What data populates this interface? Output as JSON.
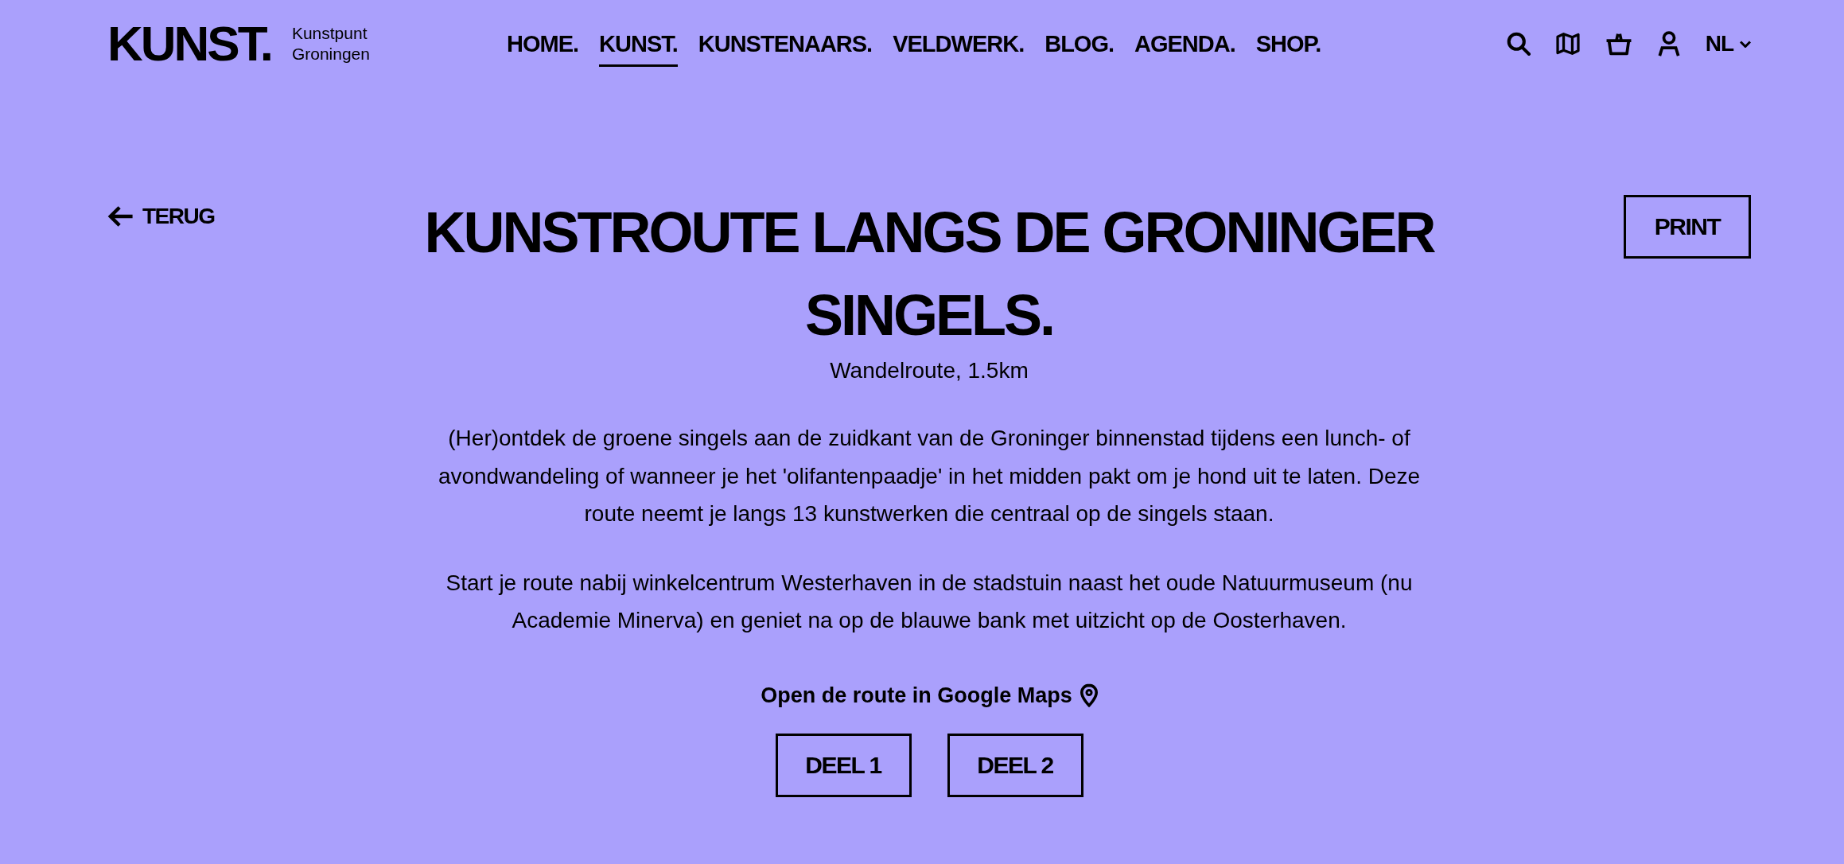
{
  "header": {
    "logo": {
      "wordmark": "KUNST.",
      "tagline": "Kunstpunt Groningen"
    },
    "nav": [
      {
        "label": "HOME.",
        "selected": false
      },
      {
        "label": "KUNST.",
        "selected": true
      },
      {
        "label": "KUNSTENAARS.",
        "selected": false
      },
      {
        "label": "VELDWERK.",
        "selected": false
      },
      {
        "label": "BLOG.",
        "selected": false
      },
      {
        "label": "AGENDA.",
        "selected": false
      },
      {
        "label": "SHOP.",
        "selected": false
      }
    ],
    "language": "NL"
  },
  "back_link": {
    "label": "TERUG"
  },
  "title": "KUNSTROUTE LANGS DE GRONINGER SINGELS.",
  "print_button": {
    "label": "PRINT"
  },
  "subtitle": "Wandelroute, 1.5km",
  "paragraphs": [
    "(Her)ontdek de groene singels aan de zuidkant van de Groninger binnenstad tijdens een lunch- of avondwandeling of wanneer je het 'olifantenpaadje' in het midden pakt om je hond uit te laten. Deze route neemt je langs 13 kunstwerken die centraal op de singels staan.",
    "Start je route nabij winkelcentrum Westerhaven in de stadstuin naast het oude Natuurmuseum (nu Academie Minerva) en geniet na op de blauwe bank met uitzicht op de Oosterhaven."
  ],
  "maps_link": {
    "label": "Open de route in Google Maps"
  },
  "route_parts": [
    {
      "label": "DEEL 1"
    },
    {
      "label": "DEEL 2"
    }
  ]
}
